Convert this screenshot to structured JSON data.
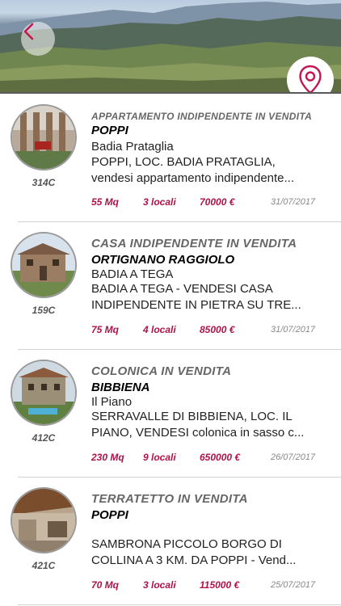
{
  "header": {
    "back_icon": "chevron-left-icon",
    "map_icon": "map-pin-icon",
    "accent": "#c2174f"
  },
  "listings": [
    {
      "code": "314C",
      "type": "APPARTAMENTO INDIPENDENTE  IN  VENDITA",
      "town": "POPPI",
      "locality": "Badia Prataglia",
      "desc_line1": "POPPI, LOC. BADIA PRATAGLIA,",
      "desc_line2": "vendesi appartamento indipendente...",
      "area": "55 Mq",
      "rooms": "3 locali",
      "price": "70000 €",
      "date": "31/07/2017"
    },
    {
      "code": "159C",
      "type": "CASA INDIPENDENTE  IN  VENDITA",
      "town": "ORTIGNANO RAGGIOLO",
      "locality": "BADIA A TEGA",
      "desc_line1": "BADIA A TEGA -  VENDESI CASA",
      "desc_line2": "INDIPENDENTE IN PIETRA SU TRE...",
      "area": "75 Mq",
      "rooms": "4 locali",
      "price": "85000 €",
      "date": "31/07/2017"
    },
    {
      "code": "412C",
      "type": "COLONICA  IN  VENDITA",
      "town": "BIBBIENA",
      "locality": "Il Piano",
      "desc_line1": "SERRAVALLE DI BIBBIENA, LOC. IL",
      "desc_line2": "PIANO, VENDESI colonica in sasso c...",
      "area": "230 Mq",
      "rooms": "9 locali",
      "price": "650000 €",
      "date": "26/07/2017"
    },
    {
      "code": "421C",
      "type": "TERRATETTO  IN  VENDITA",
      "town": "POPPI",
      "locality": "",
      "desc_line1": "SAMBRONA PICCOLO BORGO DI",
      "desc_line2": "COLLINA A 3 KM. DA POPPI - Vend...",
      "area": "70 Mq",
      "rooms": "3 locali",
      "price": "115000 €",
      "date": "25/07/2017"
    }
  ]
}
